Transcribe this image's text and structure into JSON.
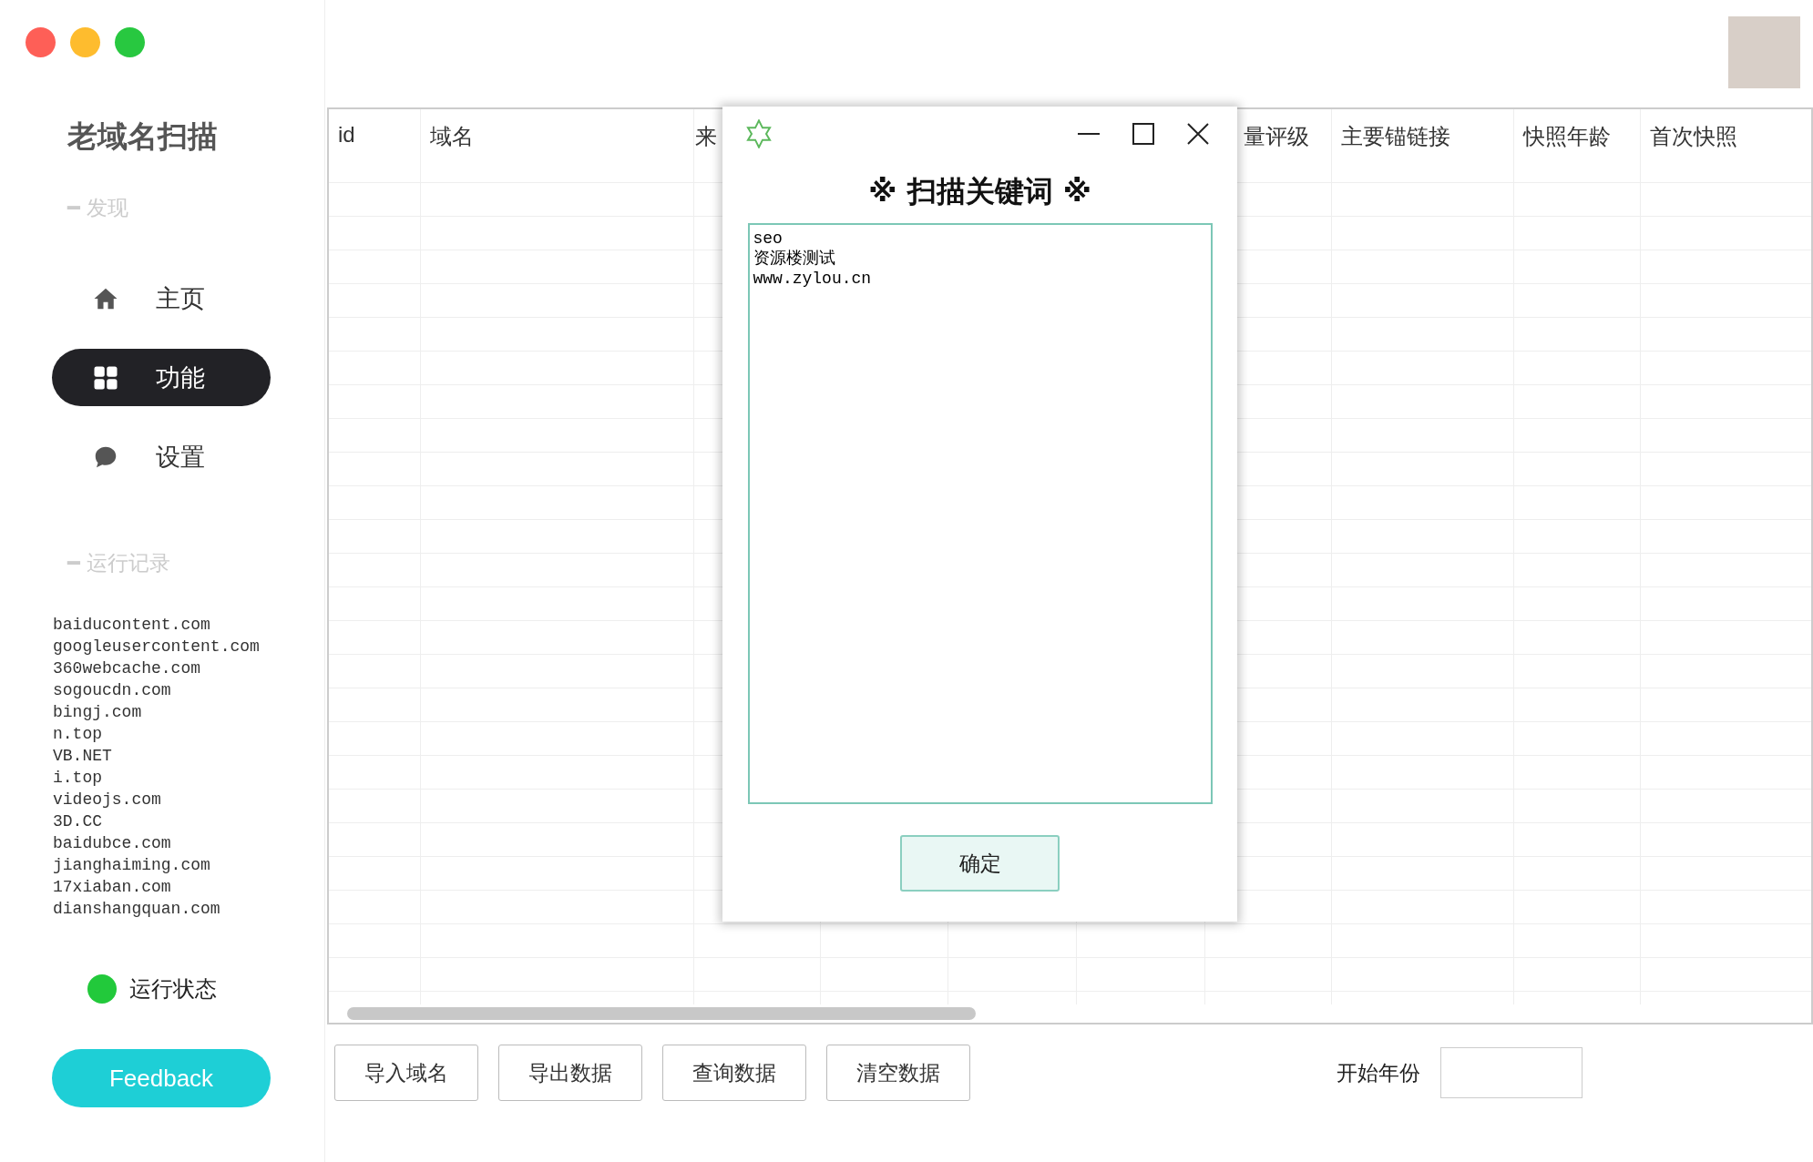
{
  "app": {
    "title": "老域名扫描"
  },
  "sidebar": {
    "sections": [
      {
        "label": "━ 发现",
        "items": [
          {
            "label": "主页",
            "selected": false
          },
          {
            "label": "功能",
            "selected": true
          },
          {
            "label": "设置",
            "selected": false
          }
        ]
      },
      {
        "label": "━ 运行记录"
      }
    ],
    "log": [
      "baiducontent.com",
      "googleusercontent.com",
      "360webcache.com",
      "sogoucdn.com",
      "bingj.com",
      "n.top",
      "VB.NET",
      "i.top",
      "videojs.com",
      "3D.CC",
      "baidubce.com",
      "jianghaiming.com",
      "17xiaban.com",
      "dianshangquan.com"
    ],
    "status": {
      "label": "运行状态",
      "running": true
    },
    "feedback": "Feedback"
  },
  "table": {
    "columns": [
      "id",
      "域名",
      "来",
      "量评级",
      "主要锚链接",
      "快照年龄",
      "首次快照"
    ]
  },
  "toolbar": {
    "buttons": [
      "导入域名",
      "导出数据",
      "查询数据",
      "清空数据"
    ],
    "start_year": {
      "label": "开始年份"
    }
  },
  "dialog": {
    "title": "※ 扫描关键词 ※",
    "keywords": "seo\n资源楼测试\nwww.zylou.cn",
    "confirm": "确定"
  }
}
